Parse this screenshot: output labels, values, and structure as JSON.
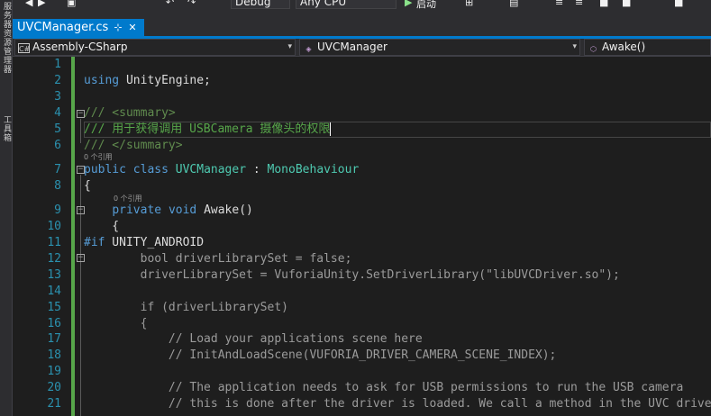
{
  "toolbar": {
    "config": "Debug",
    "platform": "Any CPU",
    "start_label": "启动"
  },
  "left_tabs": [
    "服务器资源管理器",
    "工具箱"
  ],
  "document_tab": {
    "title": "UVCManager.cs",
    "pin": "⊹",
    "close": "✕"
  },
  "navbar": {
    "project": "Assembly-CSharp",
    "class": "UVCManager",
    "member": "Awake()"
  },
  "code": {
    "line_numbers": [
      "1",
      "2",
      "3",
      "4",
      "5",
      "6",
      "7",
      "8",
      "9",
      "10",
      "11",
      "12",
      "13",
      "14",
      "15",
      "16",
      "17",
      "18",
      "19",
      "20",
      "21"
    ],
    "codelens": [
      "0 个引用",
      "0 个引用"
    ],
    "lines": [
      [],
      [
        {
          "c": "kw",
          "t": "using"
        },
        {
          "c": "tx",
          "t": " UnityEngine;"
        }
      ],
      [],
      [
        {
          "c": "xd",
          "t": "/// <summary>"
        }
      ],
      [
        {
          "c": "cm",
          "t": "/// 用于获得调用 USBCamera 摄像头的权限"
        }
      ],
      [
        {
          "c": "xd",
          "t": "/// </summary>"
        }
      ],
      [
        {
          "c": "kw",
          "t": "public"
        },
        {
          "c": "tx",
          "t": " "
        },
        {
          "c": "kw",
          "t": "class"
        },
        {
          "c": "tx",
          "t": " "
        },
        {
          "c": "ty",
          "t": "UVCManager"
        },
        {
          "c": "tx",
          "t": " : "
        },
        {
          "c": "ty",
          "t": "MonoBehaviour"
        }
      ],
      [
        {
          "c": "tx",
          "t": "{"
        }
      ],
      [
        {
          "c": "tx",
          "t": "    "
        },
        {
          "c": "kw",
          "t": "private"
        },
        {
          "c": "tx",
          "t": " "
        },
        {
          "c": "kw",
          "t": "void"
        },
        {
          "c": "tx",
          "t": " Awake()"
        }
      ],
      [
        {
          "c": "tx",
          "t": "    {"
        }
      ],
      [
        {
          "c": "kw",
          "t": "#if"
        },
        {
          "c": "tx",
          "t": " UNITY_ANDROID"
        }
      ],
      [
        {
          "c": "pp",
          "t": "        bool driverLibrarySet = false;"
        }
      ],
      [
        {
          "c": "pp",
          "t": "        driverLibrarySet = VuforiaUnity.SetDriverLibrary(\"libUVCDriver.so\");"
        }
      ],
      [],
      [
        {
          "c": "pp",
          "t": "        if (driverLibrarySet)"
        }
      ],
      [
        {
          "c": "pp",
          "t": "        {"
        }
      ],
      [
        {
          "c": "pp",
          "t": "            // Load your applications scene here"
        }
      ],
      [
        {
          "c": "pp",
          "t": "            // InitAndLoadScene(VUFORIA_DRIVER_CAMERA_SCENE_INDEX);"
        }
      ],
      [],
      [
        {
          "c": "pp",
          "t": "            // The application needs to ask for USB permissions to run the USB camera"
        }
      ],
      [
        {
          "c": "pp",
          "t": "            // this is done after the driver is loaded. We call a method in the UVC driver"
        }
      ]
    ]
  },
  "colors": {
    "accent": "#007acc",
    "keyword": "#569cd6",
    "type": "#4ec9b0",
    "comment": "#57a64a",
    "string": "#d69d85",
    "line_number": "#2b91af",
    "inactive_code": "#9b9b9b"
  }
}
